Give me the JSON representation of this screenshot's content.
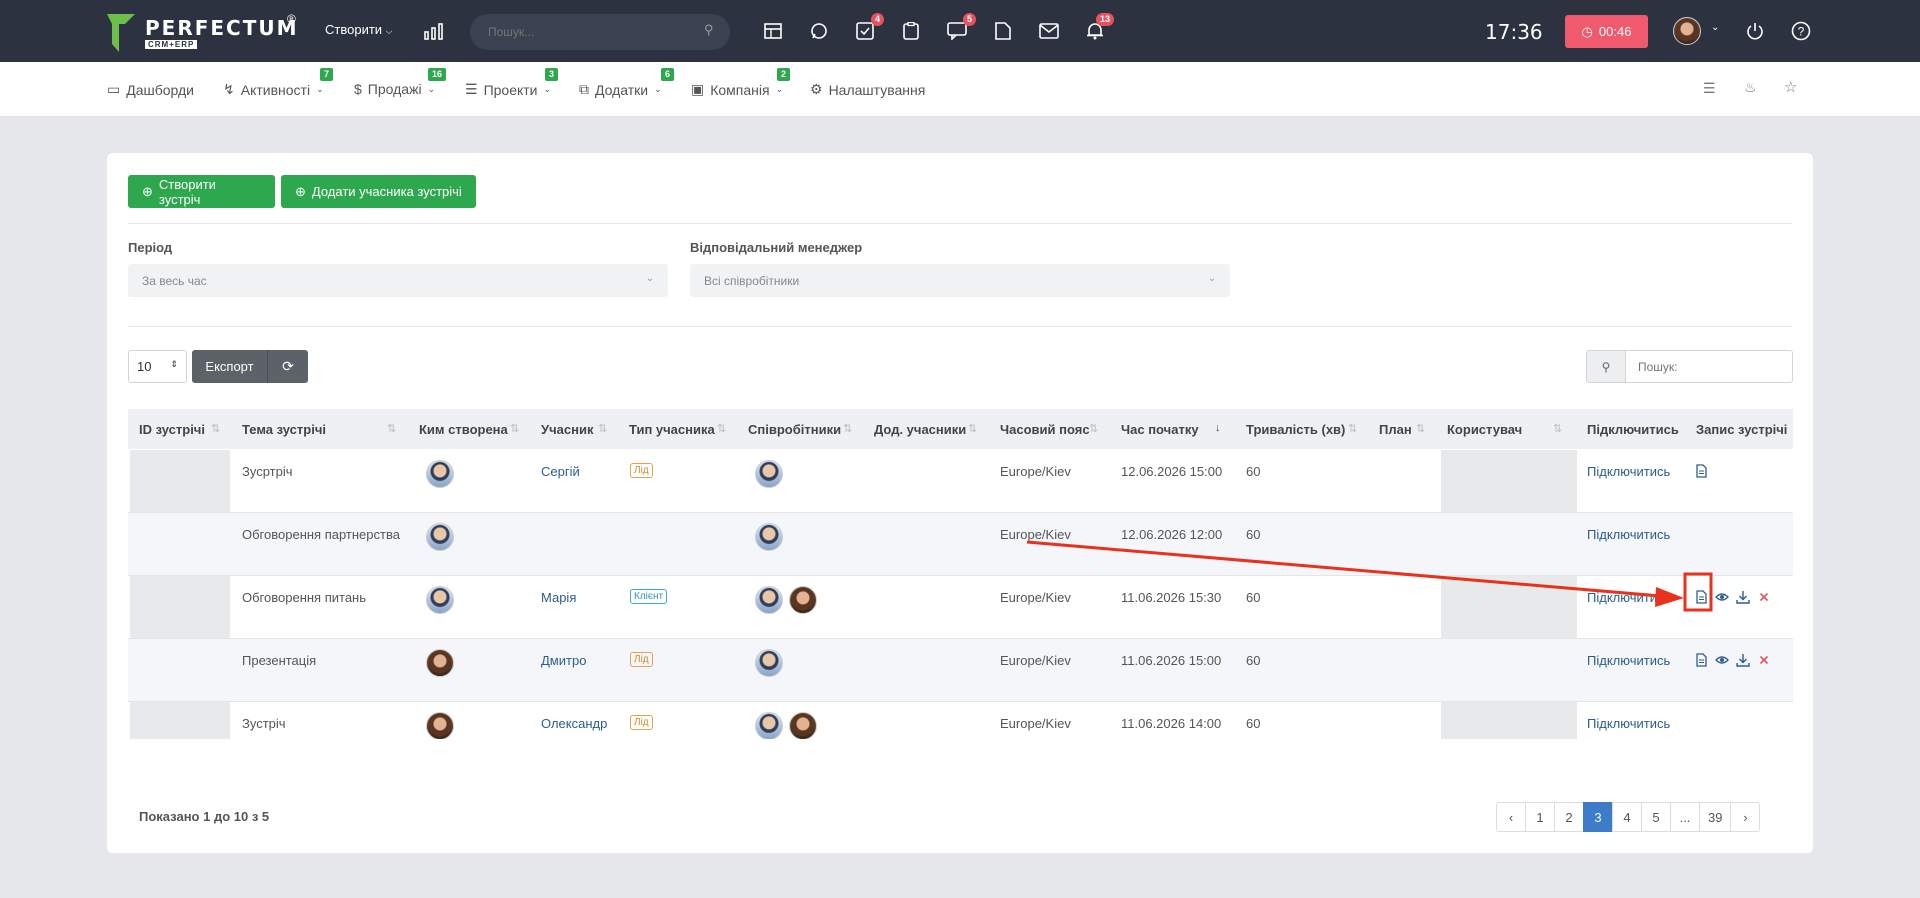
{
  "topbar": {
    "logo_text": "PERFECTUM",
    "logo_sub": "CRM+ERP",
    "logo_reg": "®",
    "create_label": "Створити",
    "search_placeholder": "Пошук...",
    "badges": {
      "tasks": "4",
      "chat": "5",
      "notifications": "13"
    },
    "clock": "17:36",
    "timer": "00:46"
  },
  "nav": {
    "items": [
      {
        "label": "Дашборди",
        "badge": ""
      },
      {
        "label": "Активності",
        "badge": "7"
      },
      {
        "label": "Продажі",
        "badge": "16"
      },
      {
        "label": "Проекти",
        "badge": "3"
      },
      {
        "label": "Додатки",
        "badge": "6"
      },
      {
        "label": "Компанія",
        "badge": "2"
      },
      {
        "label": "Налаштування",
        "badge": ""
      }
    ]
  },
  "actions": {
    "create_meeting": "Створити зустріч",
    "add_participant": "Додати учасника зустрічі"
  },
  "filters": {
    "period_label": "Період",
    "period_value": "За весь час",
    "manager_label": "Відповідальний менеджер",
    "manager_value": "Всі співробітники"
  },
  "toolbar": {
    "per_page": "10",
    "export_label": "Експорт",
    "search_placeholder": "Пошук:"
  },
  "table": {
    "headers": [
      "ID зустрічі",
      "Тема зустрічі",
      "Ким створена",
      "Учасник",
      "Тип учасника",
      "Співробітники",
      "Дод. учасники",
      "Часовий пояс",
      "Час початку",
      "Тривалість (хв)",
      "План",
      "Користувач",
      "Підключитись",
      "Запис зустрічі"
    ],
    "rows": [
      {
        "topic": "Зусртріч",
        "participant": "Сергій",
        "type": "Лід",
        "timezone": "Europe/Kiev",
        "start": "12.06.2026 15:00",
        "duration": "60",
        "connect": "Підключитись"
      },
      {
        "topic": "Обговорення партнерства",
        "participant": "",
        "type": "",
        "timezone": "Europe/Kiev",
        "start": "12.06.2026 12:00",
        "duration": "60",
        "connect": "Підключитись"
      },
      {
        "topic": "Обговорення питань",
        "participant": "Марія",
        "type": "Клієнт",
        "timezone": "Europe/Kiev",
        "start": "11.06.2026 15:30",
        "duration": "60",
        "connect": "Підключитись"
      },
      {
        "topic": "Презентація",
        "participant": "Дмитро",
        "type": "Лід",
        "timezone": "Europe/Kiev",
        "start": "11.06.2026 15:00",
        "duration": "60",
        "connect": "Підключитись"
      },
      {
        "topic": "Зустріч",
        "participant": "Олександр",
        "type": "Лід",
        "timezone": "Europe/Kiev",
        "start": "11.06.2026 14:00",
        "duration": "60",
        "connect": "Підключитись"
      }
    ]
  },
  "footer": {
    "shown_text": "Показано 1 до 10 з 5",
    "pages": [
      "1",
      "2",
      "3",
      "4",
      "5",
      "...",
      "39"
    ],
    "active_page": "3"
  },
  "colors": {
    "topbar": "#2c3240",
    "green": "#2ea84e",
    "timer": "#ef5a6f",
    "annotation": "#e8321e",
    "pager_active": "#3d7cc9"
  }
}
